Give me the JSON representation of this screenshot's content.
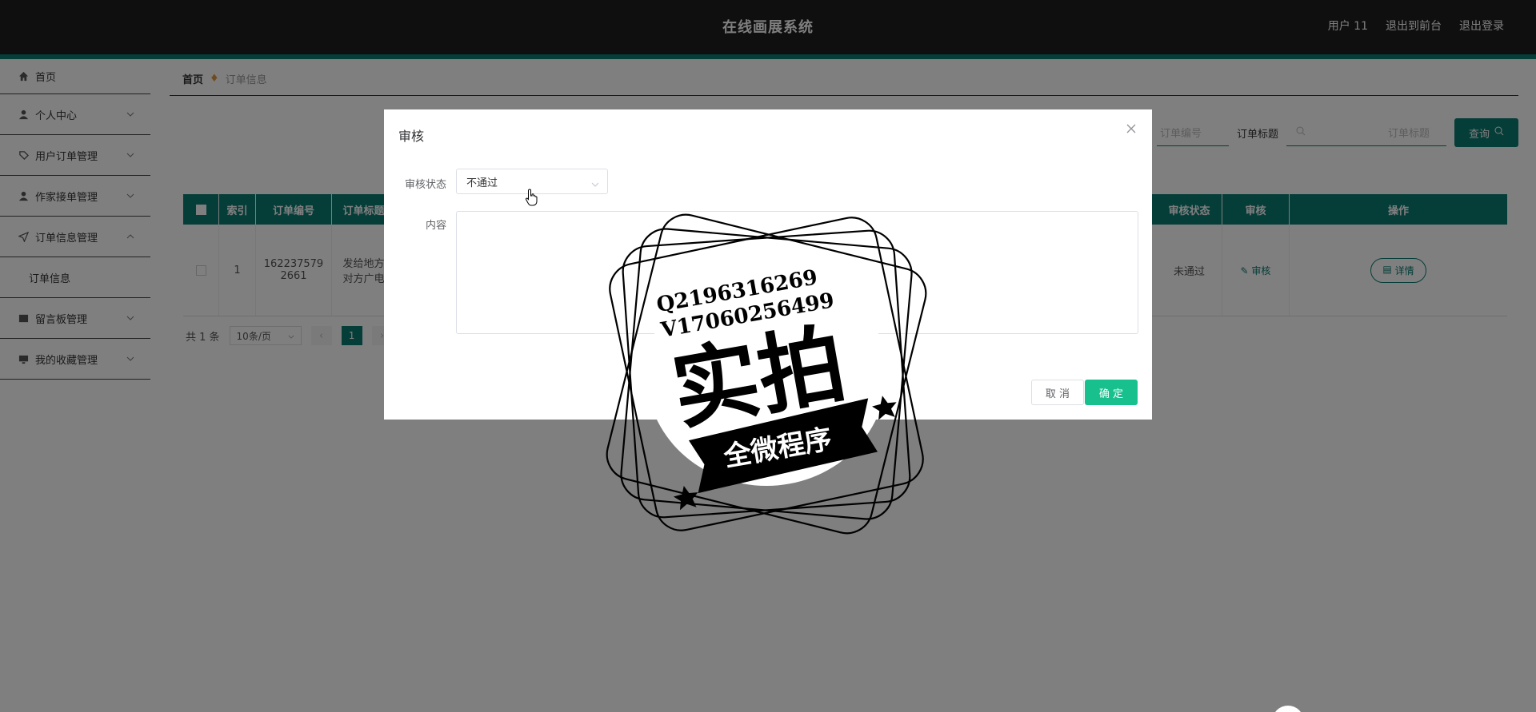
{
  "header": {
    "app_title": "在线画展系统",
    "user_label": "用户 11",
    "to_front_label": "退出到前台",
    "logout_label": "退出登录"
  },
  "sidebar": {
    "items": [
      {
        "label": "首页",
        "icon": "home-icon"
      },
      {
        "label": "个人中心",
        "icon": "user-icon"
      },
      {
        "label": "用户订单管理",
        "icon": "tag-icon"
      },
      {
        "label": "作家接单管理",
        "icon": "user-icon"
      },
      {
        "label": "订单信息管理",
        "icon": "send-icon"
      },
      {
        "label": "订单信息",
        "icon": ""
      },
      {
        "label": "留言板管理",
        "icon": "message-icon"
      },
      {
        "label": "我的收藏管理",
        "icon": "monitor-icon"
      }
    ]
  },
  "breadcrumb": {
    "home": "首页",
    "current": "订单信息"
  },
  "search": {
    "order_no_placeholder": "订单编号",
    "title_label": "订单标题",
    "title_placeholder": "订单标题",
    "button_label": "查询"
  },
  "table": {
    "headers": [
      "索引",
      "订单编号",
      "订单标题",
      "审核状态",
      "审核",
      "操作"
    ],
    "rows": [
      {
        "index": "1",
        "order_no": "1622375792661",
        "title": "发给地方对方广电",
        "status": "未通过",
        "audit_label": "审核",
        "detail_label": "详情"
      }
    ]
  },
  "pagination": {
    "total": "共 1 条",
    "page_size": "10条/页",
    "current_page": "1"
  },
  "dialog": {
    "title": "审核",
    "status_label": "审核状态",
    "status_value": "不通过",
    "content_label": "内容",
    "cancel_label": "取 消",
    "ok_label": "确 定"
  },
  "watermark": {
    "line1": "Q2196316269",
    "line2": "V17060256499",
    "big_text": "实拍",
    "ribbon_text": "全微程序"
  },
  "colors": {
    "accent": "#0b7a70",
    "confirm": "#17c08c",
    "topbar": "#1e1e1e"
  }
}
